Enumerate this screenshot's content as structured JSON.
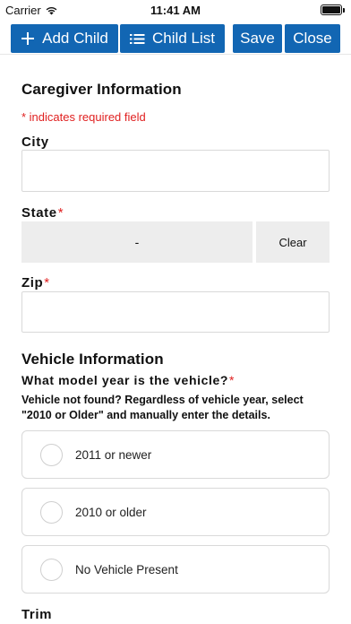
{
  "status_bar": {
    "carrier": "Carrier",
    "time": "11:41 AM",
    "wifi_icon": "wifi-icon",
    "battery_icon": "battery-icon"
  },
  "toolbar": {
    "add_child_label": "Add Child",
    "add_child_icon": "plus-icon",
    "child_list_label": "Child List",
    "child_list_icon": "list-icon",
    "save_label": "Save",
    "close_label": "Close",
    "button_color": "#1266b3"
  },
  "caregiver": {
    "title": "Caregiver Information",
    "required_note": "* indicates required field",
    "city_label": "City",
    "city_value": "",
    "state_label": "State",
    "state_required": "*",
    "state_value": "-",
    "clear_label": "Clear",
    "zip_label": "Zip",
    "zip_required": "*",
    "zip_value": ""
  },
  "vehicle": {
    "title": "Vehicle Information",
    "question": "What model year is the vehicle?",
    "question_required": "*",
    "hint": "Vehicle not found? Regardless of vehicle year, select \"2010 or Older\" and manually enter the details.",
    "options": [
      {
        "label": "2011 or newer",
        "selected": false
      },
      {
        "label": "2010 or older",
        "selected": false
      },
      {
        "label": "No Vehicle Present",
        "selected": false
      }
    ],
    "trim_label": "Trim"
  },
  "colors": {
    "required": "#e02020",
    "field_fill": "#ededed"
  }
}
